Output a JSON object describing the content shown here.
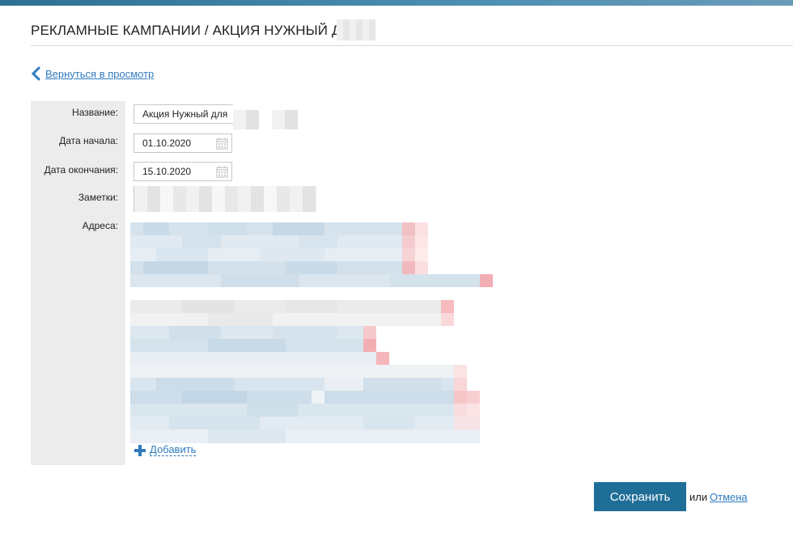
{
  "header": {
    "title": "РЕКЛАМНЫЕ КАМПАНИИ / АКЦИЯ НУЖНЫЙ ДЛЯ"
  },
  "nav": {
    "back_label": "Вернуться в просмотр"
  },
  "form": {
    "name_label": "Название:",
    "name_value": "Акция Нужный для",
    "start_label": "Дата начала:",
    "start_value": "01.10.2020",
    "end_label": "Дата окончания:",
    "end_value": "15.10.2020",
    "notes_label": "Заметки:",
    "addresses_label": "Адреса:",
    "add_label": "Добавить"
  },
  "actions": {
    "save_label": "Сохранить",
    "or_label": "или",
    "cancel_label": "Отмена"
  },
  "colors": {
    "accent": "#2f7bbf",
    "button": "#1f6e97",
    "sidebar": "#ececec"
  }
}
